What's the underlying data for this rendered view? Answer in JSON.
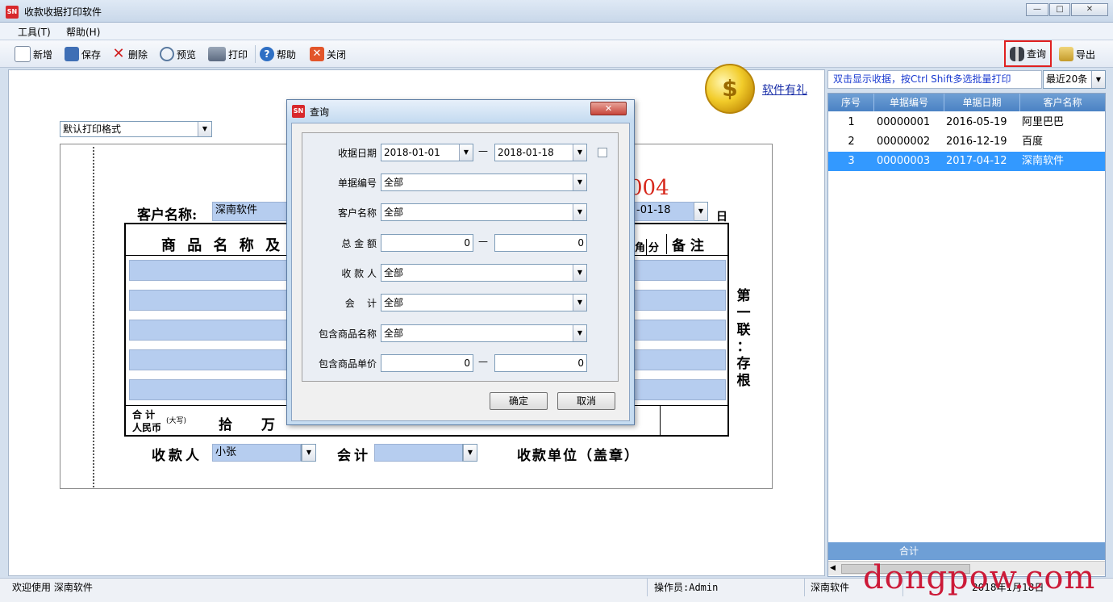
{
  "window": {
    "title": "收款收据打印软件",
    "icon_text": "SN",
    "min_glyph": "—",
    "max_glyph": "□",
    "close_glyph": "✕"
  },
  "menu": {
    "tools": "工具(T)",
    "help": "帮助(H)"
  },
  "toolbar": {
    "new": "新增",
    "save": "保存",
    "delete": "删除",
    "preview": "预览",
    "print": "打印",
    "help": "帮助",
    "close": "关闭",
    "query": "查询",
    "export": "导出"
  },
  "gift": {
    "coin_glyph": "$",
    "link": "软件有礼"
  },
  "print_format": {
    "value": "默认打印格式"
  },
  "receipt": {
    "customer_label": "客户名称:",
    "customer_value": "深南软件",
    "number_tail": "004",
    "date_tail": "-01-18",
    "day_label": "日",
    "col_goods": "商 品 名 称 及 规",
    "col_jiao": "角",
    "col_fen": "分",
    "col_remark": "备    注",
    "total_label_1": "合  计",
    "total_label_2": "人民币",
    "total_label_caps": "(大写)",
    "shi": "拾",
    "wan": "万",
    "payee_label": "收款人",
    "payee_value": "小张",
    "accountant_label": "会计",
    "accountant_value": "",
    "unit_label": "收款单位（盖章）",
    "side_text": [
      "第",
      "一",
      "联",
      "：",
      "存",
      "根"
    ]
  },
  "dialog": {
    "title": "查询",
    "close_glyph": "✕",
    "fields": {
      "date_label": "收据日期",
      "date_from": "2018-01-01",
      "date_to": "2018-01-18",
      "number_label": "单据编号",
      "number_value": "全部",
      "customer_label": "客户名称",
      "customer_value": "全部",
      "amount_label": "总 金 额",
      "amount_from": "0",
      "amount_to": "0",
      "payee_label": "收 款 人",
      "payee_value": "全部",
      "accountant_label": "会    计",
      "accountant_value": "全部",
      "goods_label": "包含商品名称",
      "goods_value": "全部",
      "price_label": "包含商品单价",
      "price_from": "0",
      "price_to": "0",
      "dash": "—"
    },
    "ok": "确定",
    "cancel": "取消"
  },
  "right_panel": {
    "hint": "双击显示收据，按Ctrl Shift多选批量打印",
    "recent": "最近20条",
    "columns": [
      "序号",
      "单据编号",
      "单据日期",
      "客户名称"
    ],
    "rows": [
      {
        "seq": "1",
        "number": "00000001",
        "date": "2016-05-19",
        "customer": "阿里巴巴"
      },
      {
        "seq": "2",
        "number": "00000002",
        "date": "2016-12-19",
        "customer": "百度"
      },
      {
        "seq": "3",
        "number": "00000003",
        "date": "2017-04-12",
        "customer": "深南软件"
      }
    ],
    "total_label": "合计"
  },
  "status": {
    "welcome": "欢迎使用  深南软件",
    "operator": "操作员:Admin",
    "company": "深南软件",
    "date_partial": "2018年1月18日"
  },
  "watermark": "dongpow.com",
  "colors": {
    "accent": "#3399ff",
    "header": "#4a82c4",
    "field_blue": "#b6cdef",
    "red": "#d7281c"
  }
}
